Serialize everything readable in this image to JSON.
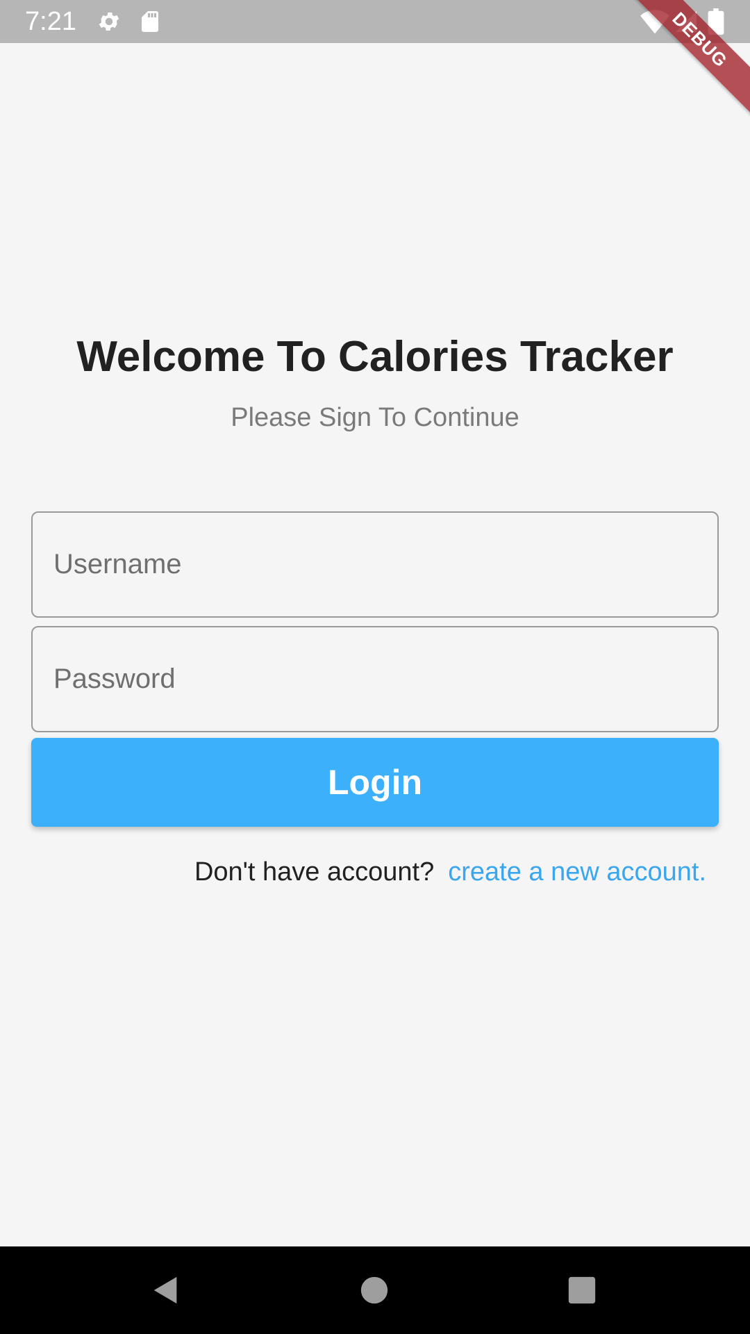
{
  "status_bar": {
    "time": "7:21",
    "left_icons": [
      "gear-icon",
      "sd-card-icon"
    ],
    "right_icons": [
      "wifi-icon",
      "signal-icon",
      "battery-icon"
    ]
  },
  "debug_banner": "DEBUG",
  "login": {
    "title": "Welcome To Calories Tracker",
    "subtitle": "Please Sign To Continue",
    "username_placeholder": "Username",
    "username_value": "",
    "password_placeholder": "Password",
    "password_value": "",
    "login_button_label": "Login",
    "signup_prompt": "Don't have account?",
    "signup_link": "create a new account."
  },
  "nav_bar": {
    "icons": [
      "back-icon",
      "home-icon",
      "recents-icon"
    ]
  },
  "colors": {
    "background": "#f5f5f5",
    "status_bar": "#b6b6b6",
    "accent": "#3db0fb",
    "link": "#3aa6ee",
    "title": "#212121",
    "subtitle": "#7a7a7a",
    "debug_ribbon": "#a02028"
  }
}
